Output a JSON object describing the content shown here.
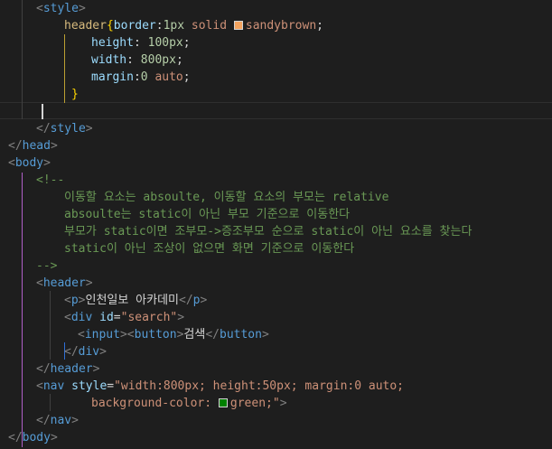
{
  "editor": {
    "lines": [
      {
        "id": "l1",
        "segments": [
          {
            "c": "br",
            "t": "<"
          },
          {
            "c": "tag",
            "t": "style"
          },
          {
            "c": "br",
            "t": ">"
          }
        ]
      },
      {
        "id": "l2",
        "segments": [
          {
            "c": "sel",
            "t": "header"
          },
          {
            "c": "brace-gold",
            "t": "{"
          },
          {
            "c": "prop",
            "t": "border"
          },
          {
            "c": "txt",
            "t": ":"
          },
          {
            "c": "num",
            "t": "1px"
          },
          {
            "c": "txt",
            "t": " "
          },
          {
            "c": "val",
            "t": "solid "
          },
          {
            "swatch": "sandybrown"
          },
          {
            "c": "val",
            "t": "sandybrown"
          },
          {
            "c": "txt",
            "t": ";"
          }
        ]
      },
      {
        "id": "l3",
        "segments": [
          {
            "c": "prop",
            "t": "height"
          },
          {
            "c": "txt",
            "t": ": "
          },
          {
            "c": "num",
            "t": "100px"
          },
          {
            "c": "txt",
            "t": ";"
          }
        ]
      },
      {
        "id": "l4",
        "segments": [
          {
            "c": "prop",
            "t": "width"
          },
          {
            "c": "txt",
            "t": ": "
          },
          {
            "c": "num",
            "t": "800px"
          },
          {
            "c": "txt",
            "t": ";"
          }
        ]
      },
      {
        "id": "l5",
        "segments": [
          {
            "c": "prop",
            "t": "margin"
          },
          {
            "c": "txt",
            "t": ":"
          },
          {
            "c": "num",
            "t": "0"
          },
          {
            "c": "txt",
            "t": " "
          },
          {
            "c": "val",
            "t": "auto"
          },
          {
            "c": "txt",
            "t": ";"
          }
        ]
      },
      {
        "id": "l6",
        "segments": [
          {
            "c": "brace-gold",
            "t": "}"
          }
        ]
      },
      {
        "id": "l7",
        "segments": []
      },
      {
        "id": "l8",
        "segments": [
          {
            "c": "br",
            "t": "</"
          },
          {
            "c": "tag",
            "t": "style"
          },
          {
            "c": "br",
            "t": ">"
          }
        ]
      },
      {
        "id": "l9",
        "segments": [
          {
            "c": "br",
            "t": "</"
          },
          {
            "c": "tag",
            "t": "head"
          },
          {
            "c": "br",
            "t": ">"
          }
        ]
      },
      {
        "id": "l10",
        "segments": [
          {
            "c": "br",
            "t": "<"
          },
          {
            "c": "tag",
            "t": "body"
          },
          {
            "c": "br",
            "t": ">"
          }
        ]
      },
      {
        "id": "l11",
        "segments": [
          {
            "c": "cmt",
            "t": "<!--"
          }
        ]
      },
      {
        "id": "l12",
        "segments": [
          {
            "c": "cmt",
            "t": "이동할 요소는 absoulte, 이동할 요소의 부모는 relative"
          }
        ]
      },
      {
        "id": "l13",
        "segments": [
          {
            "c": "cmt",
            "t": "absoulte는 static이 아닌 부모 기준으로 이동한다"
          }
        ]
      },
      {
        "id": "l14",
        "segments": [
          {
            "c": "cmt",
            "t": "부모가 static이면 조부모->증조부모 순으로 static이 아닌 요소를 찾는다"
          }
        ]
      },
      {
        "id": "l15",
        "segments": [
          {
            "c": "cmt",
            "t": "static이 아닌 조상이 없으면 화면 기준으로 이동한다"
          }
        ]
      },
      {
        "id": "l16",
        "segments": [
          {
            "c": "cmt",
            "t": "-->"
          }
        ]
      },
      {
        "id": "l17",
        "segments": [
          {
            "c": "br",
            "t": "<"
          },
          {
            "c": "tag",
            "t": "header"
          },
          {
            "c": "br",
            "t": ">"
          }
        ]
      },
      {
        "id": "l18",
        "segments": [
          {
            "c": "br",
            "t": "<"
          },
          {
            "c": "tag",
            "t": "p"
          },
          {
            "c": "br",
            "t": ">"
          },
          {
            "c": "txt",
            "t": "인천일보 아카데미"
          },
          {
            "c": "br",
            "t": "</"
          },
          {
            "c": "tag",
            "t": "p"
          },
          {
            "c": "br",
            "t": ">"
          }
        ]
      },
      {
        "id": "l19",
        "segments": [
          {
            "c": "br",
            "t": "<"
          },
          {
            "c": "tag",
            "t": "div"
          },
          {
            "c": "txt",
            "t": " "
          },
          {
            "c": "attr",
            "t": "id"
          },
          {
            "c": "txt",
            "t": "="
          },
          {
            "c": "str",
            "t": "\"search\""
          },
          {
            "c": "br",
            "t": ">"
          }
        ]
      },
      {
        "id": "l20",
        "segments": [
          {
            "c": "br",
            "t": "<"
          },
          {
            "c": "tag",
            "t": "input"
          },
          {
            "c": "br",
            "t": ">"
          },
          {
            "c": "br",
            "t": "<"
          },
          {
            "c": "tag",
            "t": "button"
          },
          {
            "c": "br",
            "t": ">"
          },
          {
            "c": "txt",
            "t": "검색"
          },
          {
            "c": "br",
            "t": "</"
          },
          {
            "c": "tag",
            "t": "button"
          },
          {
            "c": "br",
            "t": ">"
          }
        ]
      },
      {
        "id": "l21",
        "segments": [
          {
            "c": "br",
            "t": "</"
          },
          {
            "c": "tag",
            "t": "div"
          },
          {
            "c": "br",
            "t": ">"
          }
        ]
      },
      {
        "id": "l22",
        "segments": [
          {
            "c": "br",
            "t": "</"
          },
          {
            "c": "tag",
            "t": "header"
          },
          {
            "c": "br",
            "t": ">"
          }
        ]
      },
      {
        "id": "l23",
        "segments": [
          {
            "c": "br",
            "t": "<"
          },
          {
            "c": "tag",
            "t": "nav"
          },
          {
            "c": "txt",
            "t": " "
          },
          {
            "c": "attr",
            "t": "style"
          },
          {
            "c": "txt",
            "t": "="
          },
          {
            "c": "str",
            "t": "\"width:800px; height:50px; margin:0 auto;"
          }
        ]
      },
      {
        "id": "l24",
        "segments": [
          {
            "c": "str",
            "t": "background-color: "
          },
          {
            "swatch": "green"
          },
          {
            "c": "str",
            "t": "green;\""
          },
          {
            "c": "br",
            "t": ">"
          }
        ]
      },
      {
        "id": "l25",
        "segments": [
          {
            "c": "br",
            "t": "</"
          },
          {
            "c": "tag",
            "t": "nav"
          },
          {
            "c": "br",
            "t": ">"
          }
        ]
      },
      {
        "id": "l26",
        "segments": [
          {
            "c": "br",
            "t": "</"
          },
          {
            "c": "tag",
            "t": "body"
          },
          {
            "c": "br",
            "t": ">"
          }
        ]
      }
    ]
  }
}
